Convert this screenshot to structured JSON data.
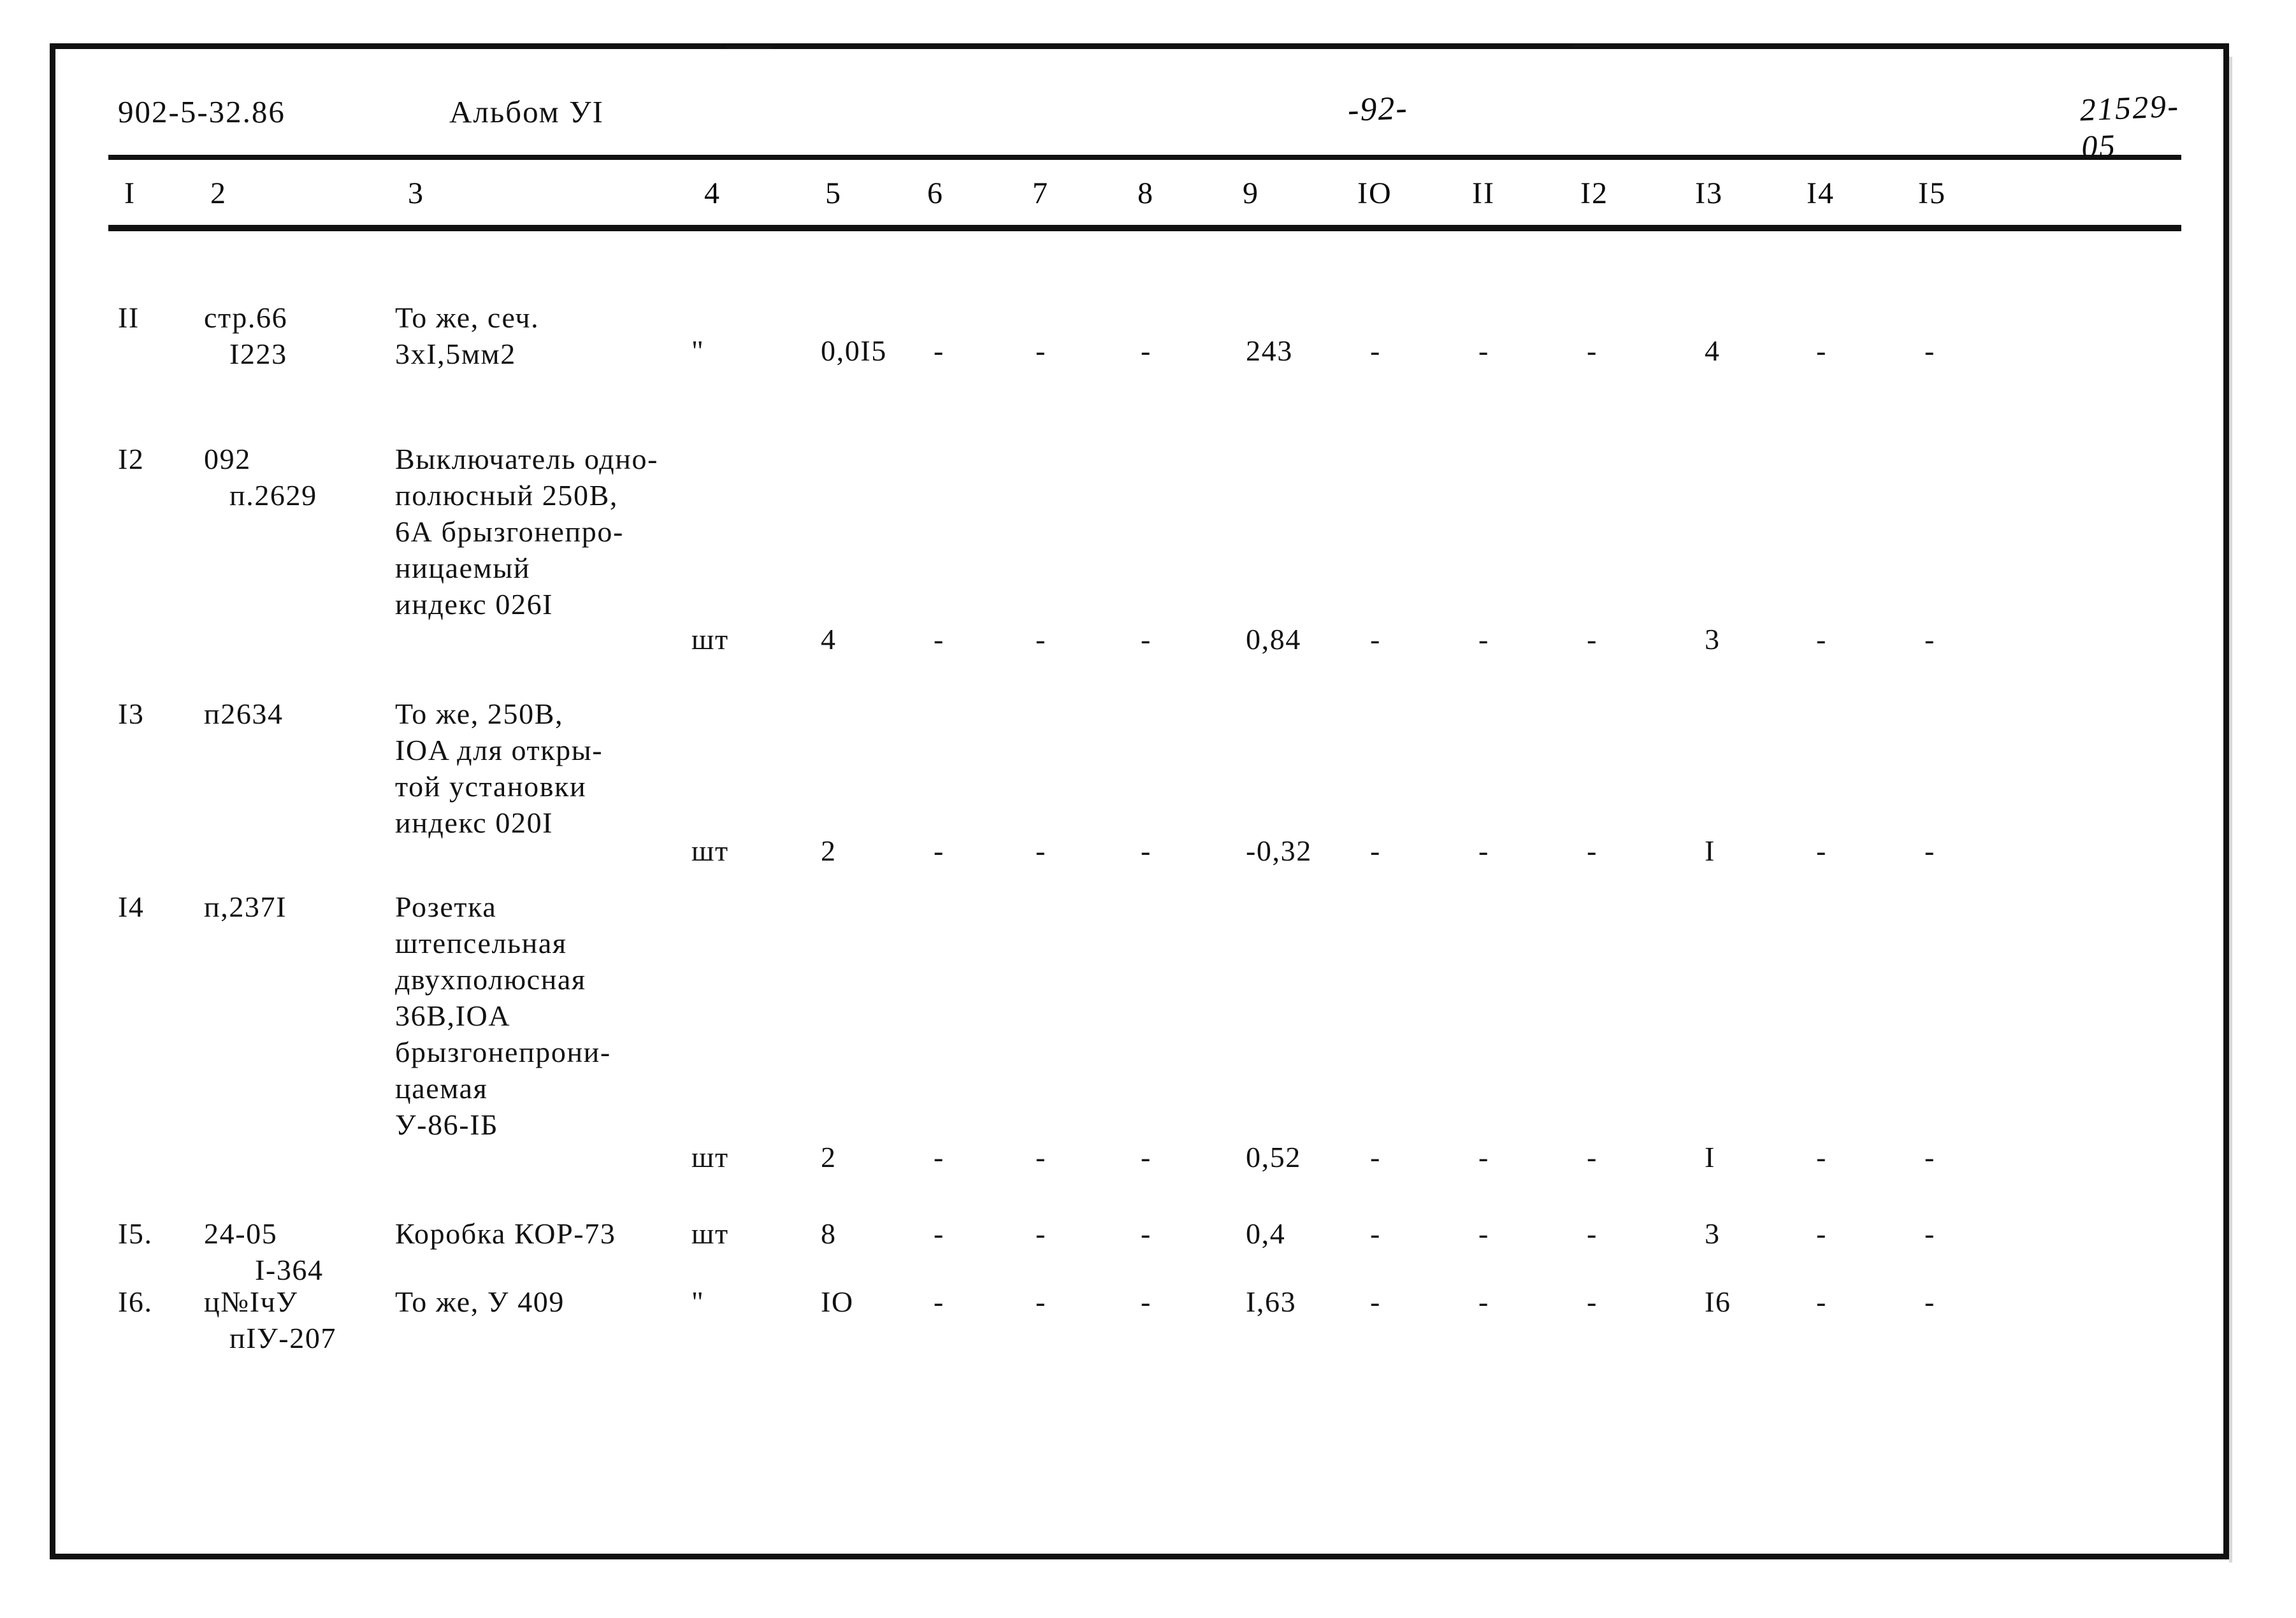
{
  "document": {
    "code": "902-5-32.86",
    "album": "Альбом УI",
    "page_number": "-92-",
    "sheet_code": "21529-05"
  },
  "table": {
    "column_headers": [
      "I",
      "2",
      "3",
      "4",
      "5",
      "6",
      "7",
      "8",
      "9",
      "IO",
      "II",
      "I2",
      "I3",
      "I4",
      "I5"
    ],
    "rows": [
      {
        "num": "II",
        "ref_lines": [
          "стр.66",
          "I223"
        ],
        "desc_lines": [
          "То же, сеч.",
          "3xI,5мм2"
        ],
        "unit": "\"",
        "c5": "0,0I5",
        "c6": "-",
        "c7": "-",
        "c8": "-",
        "c9": "243",
        "c10": "-",
        "c11": "-",
        "c12": "-",
        "c13": "4",
        "c14": "-",
        "c15": "-"
      },
      {
        "num": "I2",
        "ref_lines": [
          "092",
          "п.2629"
        ],
        "desc_lines": [
          "Выключатель одно-",
          "полюсный 250В,",
          "6А брызгонепро-",
          "ницаемый",
          "индекс 026I"
        ],
        "unit": "шт",
        "c5": "4",
        "c6": "-",
        "c7": "-",
        "c8": "-",
        "c9": "0,84",
        "c10": "-",
        "c11": "-",
        "c12": "-",
        "c13": "3",
        "c14": "-",
        "c15": "-"
      },
      {
        "num": "I3",
        "ref_lines": [
          "п2634"
        ],
        "desc_lines": [
          "То же, 250В,",
          "IOA для откры-",
          "той установки",
          "индекс 020I"
        ],
        "unit": "шт",
        "c5": "2",
        "c6": "-",
        "c7": "-",
        "c8": "-",
        "c9": "-0,32",
        "c10": "-",
        "c11": "-",
        "c12": "-",
        "c13": "I",
        "c14": "-",
        "c15": "-"
      },
      {
        "num": "I4",
        "ref_lines": [
          "п,237I"
        ],
        "desc_lines": [
          "Розетка",
          "штепсельная",
          "двухполюсная",
          "36В,IOA",
          "брызгонепрони-",
          "цаемая",
          "У-86-IБ"
        ],
        "unit": "шт",
        "c5": "2",
        "c6": "-",
        "c7": "-",
        "c8": "-",
        "c9": "0,52",
        "c10": "-",
        "c11": "-",
        "c12": "-",
        "c13": "I",
        "c14": "-",
        "c15": "-"
      },
      {
        "num": "I5.",
        "ref_lines": [
          "24-05",
          "I-364"
        ],
        "desc_lines": [
          "Коробка КОР-73"
        ],
        "unit": "шт",
        "c5": "8",
        "c6": "-",
        "c7": "-",
        "c8": "-",
        "c9": "0,4",
        "c10": "-",
        "c11": "-",
        "c12": "-",
        "c13": "3",
        "c14": "-",
        "c15": "-"
      },
      {
        "num": "I6.",
        "ref_lines": [
          "ц№IчУ",
          "пIУ-207"
        ],
        "desc_lines": [
          "То же, У 409"
        ],
        "unit": "\"",
        "c5": "IO",
        "c6": "-",
        "c7": "-",
        "c8": "-",
        "c9": "I,63",
        "c10": "-",
        "c11": "-",
        "c12": "-",
        "c13": "I6",
        "c14": "-",
        "c15": "-"
      }
    ]
  }
}
